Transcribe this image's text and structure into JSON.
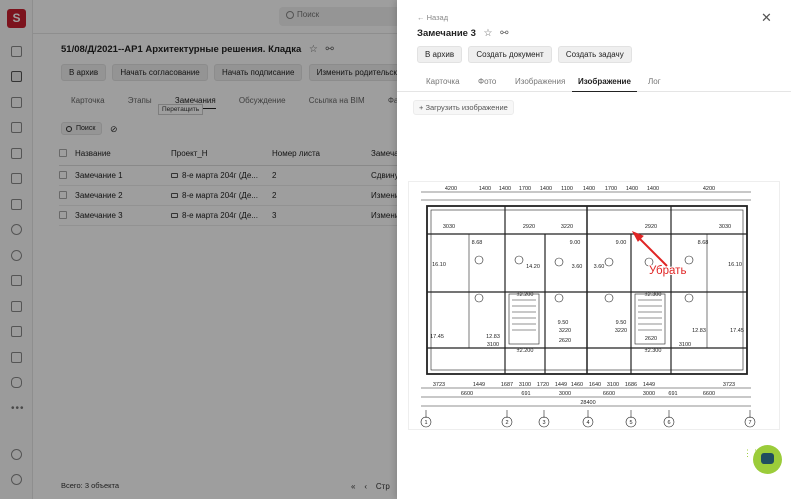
{
  "app": {
    "logo_letter": "S"
  },
  "topbar": {
    "search_placeholder": "Поиск"
  },
  "document": {
    "title": "51/08/Д/2021--АР1 Архитектурные решения. Кладка",
    "actions": [
      "В архив",
      "Начать согласование",
      "Начать подписание",
      "Изменить родительскую задачу"
    ],
    "tabs": [
      "Карточка",
      "Этапы",
      "Замечания",
      "Обсуждение",
      "Ссылка на BIM",
      "Файлы"
    ],
    "active_tab": "Замечания",
    "tooltip": "Перетащить",
    "search_label": "Поиск",
    "table": {
      "headers": [
        "Название",
        "Проект_Н",
        "Номер листа",
        "Замеча"
      ],
      "rows": [
        [
          "Замечание 1",
          "8-е марта 204г (Де...",
          "2",
          "Сдвину"
        ],
        [
          "Замечание 2",
          "8-е марта 204г (Де...",
          "2",
          "Изменит"
        ],
        [
          "Замечание 3",
          "8-е марта 204г (Де...",
          "3",
          "Изменит"
        ]
      ]
    },
    "footer": "Всего: 3 объекта",
    "pager_label": "Стр"
  },
  "panel": {
    "back": "Назад",
    "title": "Замечание 3",
    "actions": [
      "В архив",
      "Создать документ",
      "Создать задачу"
    ],
    "tabs": [
      "Карточка",
      "Фото",
      "Изображения",
      "Изображение",
      "Лог"
    ],
    "active_tab": "Изображение",
    "upload": "Загрузить изображение",
    "annotation": "Убрать",
    "drawing": {
      "top_dims": [
        "4200",
        "1400",
        "1400",
        "1700",
        "1400",
        "1100",
        "1400",
        "1700",
        "1400",
        "1400",
        "4200"
      ],
      "bottom_dims": [
        "3723",
        "1449",
        "1687",
        "3100",
        "1720",
        "1449",
        "1460",
        "1640",
        "3100",
        "1686",
        "1449",
        "3723"
      ],
      "bottom_dims2": [
        "6600",
        "691",
        "3000",
        "6600",
        "3000",
        "691",
        "6600"
      ],
      "total": "28400",
      "axes": [
        "1",
        "2",
        "3",
        "4",
        "5",
        "6",
        "7"
      ],
      "room_labels": [
        "3030",
        "2920",
        "3220",
        "2920",
        "3030",
        "8.68",
        "9.00",
        "9.00",
        "8.68",
        "16.10",
        "16.10",
        "14.20",
        "3.60",
        "3.60",
        "12.83",
        "12.83",
        "9.50",
        "9.50",
        "17.45",
        "17.45",
        "3220",
        "3220",
        "2620",
        "2620",
        "3100",
        "3100"
      ],
      "level_marks": [
        "±2.200",
        "±2.200",
        "±2.300",
        "±2.300"
      ]
    }
  }
}
